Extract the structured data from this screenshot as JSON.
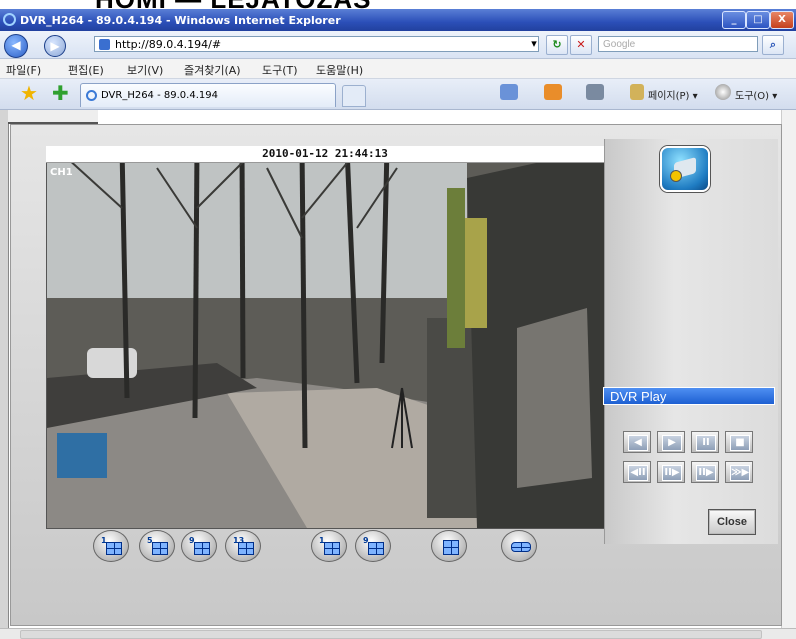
{
  "banner": {
    "text": "HOMI — LEJATOZAS"
  },
  "window": {
    "title": "DVR_H264 - 89.0.4.194 - Windows Internet Explorer",
    "minimize": "_",
    "maximize": "□",
    "close": "X"
  },
  "address": {
    "url": "http://89.0.4.194/#",
    "search_placeholder": "Google",
    "dropdown": "▾",
    "refresh": "↻",
    "stop": "✕",
    "search_go": "⌕"
  },
  "nav": {
    "back": "◀",
    "forward": "▶"
  },
  "menu": {
    "items": [
      "파일(F)",
      "편집(E)",
      "보기(V)",
      "즐겨찾기(A)",
      "도구(T)",
      "도움말(H)"
    ]
  },
  "tabs": {
    "active": "DVR_H264 - 89.0.4.194"
  },
  "commands": {
    "page": "페이지(P) ▾",
    "tools": "도구(O) ▾"
  },
  "viewer": {
    "timestamp": "2010-01-12 21:44:13",
    "channel": "CH1",
    "panel_title": "DVR Play",
    "close_label": "Close",
    "playback_row1": [
      "◀",
      "▶",
      "II",
      "■"
    ],
    "playback_row2": [
      "◀II",
      "II▶",
      "II▶",
      "≫▶"
    ],
    "split_buttons": [
      {
        "name": "split-1-button",
        "label": "1"
      },
      {
        "name": "split-5-button",
        "label": "5"
      },
      {
        "name": "split-9-button",
        "label": "9"
      },
      {
        "name": "split-13-button",
        "label": "13"
      },
      {
        "name": "split-1b-button",
        "label": "1"
      },
      {
        "name": "split-9b-button",
        "label": "9"
      },
      {
        "name": "split-16-button",
        "label": ""
      },
      {
        "name": "record-button",
        "label": ""
      }
    ]
  }
}
